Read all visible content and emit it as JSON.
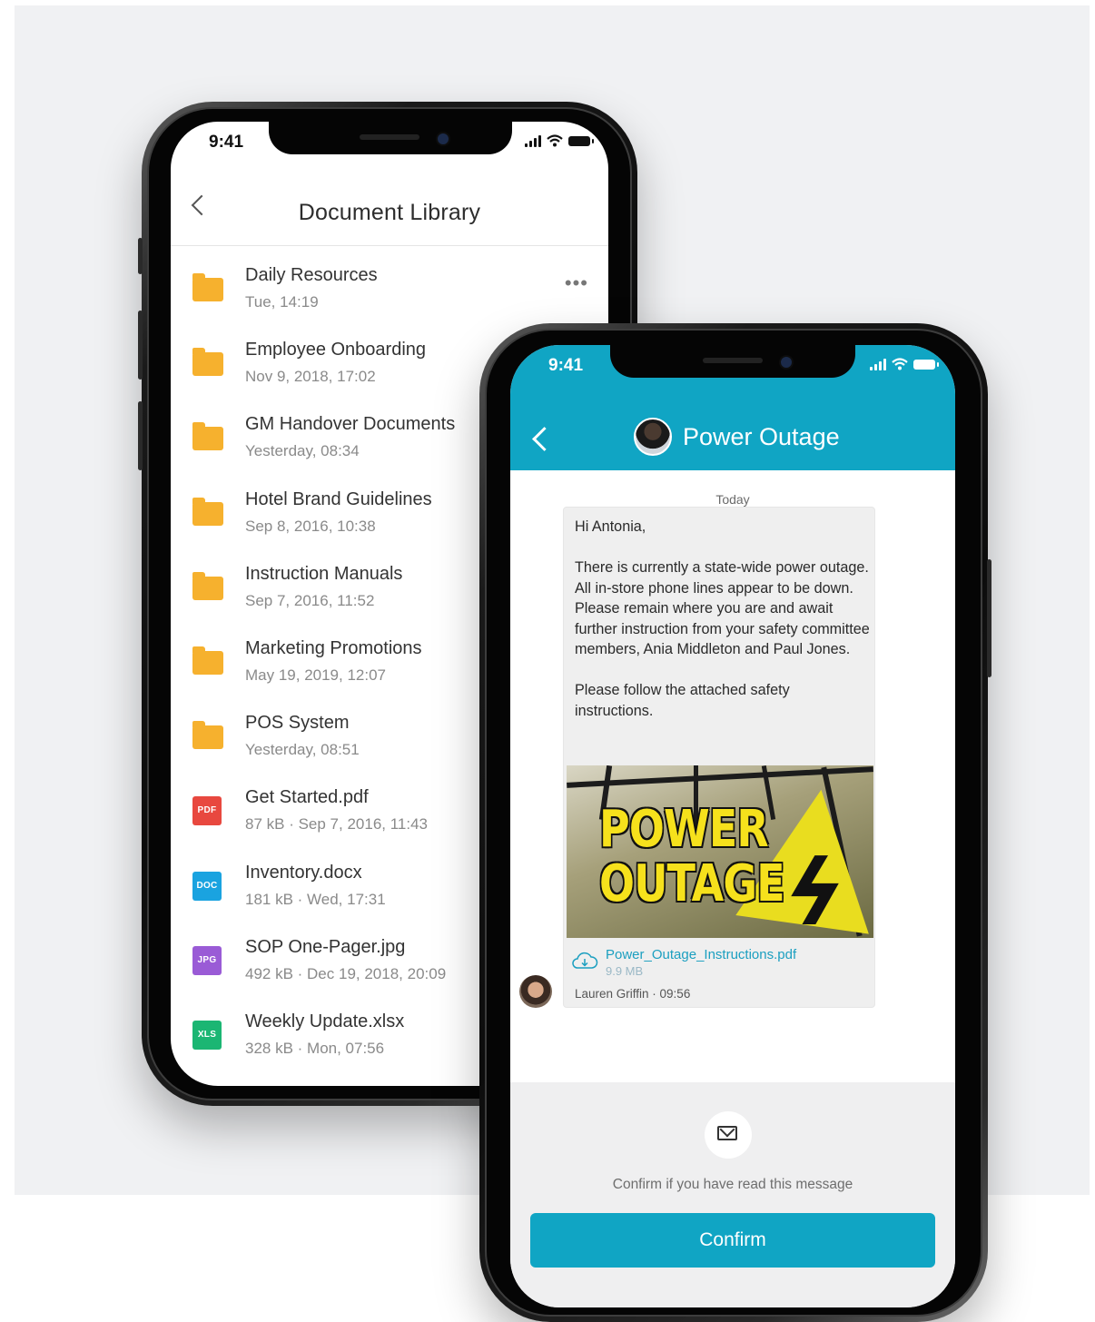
{
  "library": {
    "status_time": "9:41",
    "title": "Document Library",
    "items": [
      {
        "name": "Daily Resources",
        "meta": "Tue, 14:19",
        "type": "folder"
      },
      {
        "name": "Employee Onboarding",
        "meta": "Nov 9, 2018, 17:02",
        "type": "folder"
      },
      {
        "name": "GM Handover Documents",
        "meta": "Yesterday, 08:34",
        "type": "folder"
      },
      {
        "name": "Hotel Brand Guidelines",
        "meta": "Sep 8, 2016, 10:38",
        "type": "folder"
      },
      {
        "name": "Instruction Manuals",
        "meta": "Sep 7, 2016, 11:52",
        "type": "folder"
      },
      {
        "name": "Marketing Promotions",
        "meta": "May 19, 2019, 12:07",
        "type": "folder"
      },
      {
        "name": "POS System",
        "meta": "Yesterday, 08:51",
        "type": "folder"
      },
      {
        "name": "Get Started.pdf",
        "meta": "87 kB  ·  Sep 7, 2016, 11:43",
        "type": "PDF",
        "color": "#e8483f"
      },
      {
        "name": "Inventory.docx",
        "meta": "181 kB  ·  Wed, 17:31",
        "type": "DOC",
        "color": "#1aa3e0"
      },
      {
        "name": "SOP One-Pager.jpg",
        "meta": "492 kB  ·  Dec 19, 2018, 20:09",
        "type": "JPG",
        "color": "#9a5bd6"
      },
      {
        "name": "Weekly Update.xlsx",
        "meta": "328 kB  ·  Mon, 07:56",
        "type": "XLS",
        "color": "#1bb673"
      }
    ],
    "folder_color": "#f6b12e"
  },
  "chat": {
    "status_time": "9:41",
    "title": "Power Outage",
    "day_label": "Today",
    "message": "Hi Antonia,\n\nThere is currently a state-wide power outage. All in-store phone lines appear to be down.\nPlease remain where you are and await further instruction from your safety committee members, Ania Middleton and Paul Jones.\n\nPlease follow the attached safety instructions.",
    "image_text_line1": "POWER",
    "image_text_line2": "OUTAGE",
    "attachment_name": "Power_Outage_Instructions.pdf",
    "attachment_size": "9.9 MB",
    "sender": "Lauren Griffin · 09:56",
    "confirm_prompt": "Confirm if you have read this message",
    "confirm_label": "Confirm",
    "accent_color": "#10a5c4"
  }
}
